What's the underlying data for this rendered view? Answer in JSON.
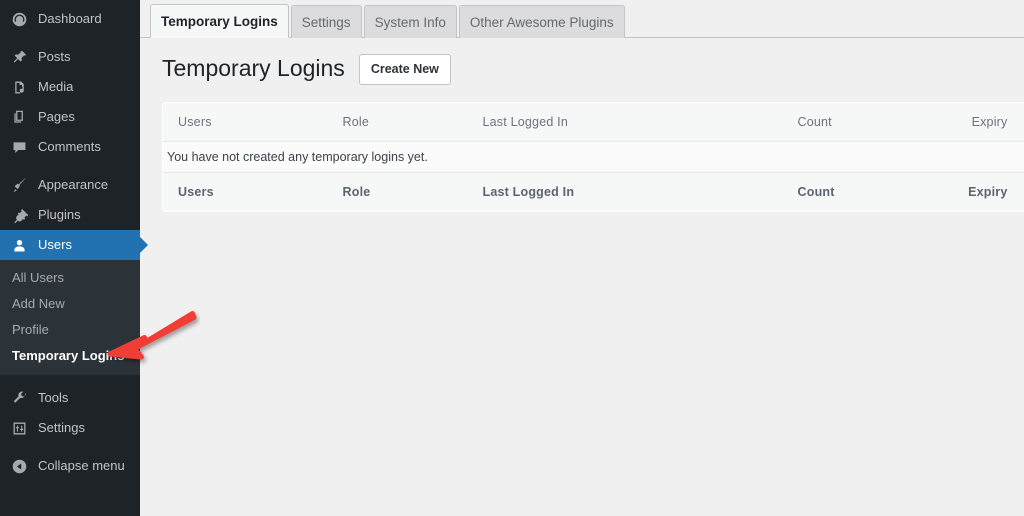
{
  "sidebar": {
    "items": [
      {
        "label": "Dashboard",
        "icon": "dashboard-icon",
        "name": "sidebar-item-dashboard",
        "current": false,
        "gap": false
      },
      {
        "label": "Posts",
        "icon": "pin-icon",
        "name": "sidebar-item-posts",
        "current": false,
        "gap": true
      },
      {
        "label": "Media",
        "icon": "media-icon",
        "name": "sidebar-item-media",
        "current": false,
        "gap": false
      },
      {
        "label": "Pages",
        "icon": "pages-icon",
        "name": "sidebar-item-pages",
        "current": false,
        "gap": false
      },
      {
        "label": "Comments",
        "icon": "comments-icon",
        "name": "sidebar-item-comments",
        "current": false,
        "gap": false
      },
      {
        "label": "Appearance",
        "icon": "paintbrush-icon",
        "name": "sidebar-item-appearance",
        "current": false,
        "gap": true
      },
      {
        "label": "Plugins",
        "icon": "plug-icon",
        "name": "sidebar-item-plugins",
        "current": false,
        "gap": false
      },
      {
        "label": "Users",
        "icon": "user-icon",
        "name": "sidebar-item-users",
        "current": true,
        "gap": false
      }
    ],
    "submenu": [
      {
        "label": "All Users",
        "name": "submenu-item-all-users",
        "current": false
      },
      {
        "label": "Add New",
        "name": "submenu-item-add-new",
        "current": false
      },
      {
        "label": "Profile",
        "name": "submenu-item-profile",
        "current": false
      },
      {
        "label": "Temporary Logins",
        "name": "submenu-item-temporary-logins",
        "current": true
      }
    ],
    "items_after": [
      {
        "label": "Tools",
        "icon": "wrench-icon",
        "name": "sidebar-item-tools",
        "current": false,
        "gap": true
      },
      {
        "label": "Settings",
        "icon": "settings-sliders-icon",
        "name": "sidebar-item-settings",
        "current": false,
        "gap": false
      }
    ],
    "collapse": {
      "label": "Collapse menu",
      "icon": "collapse-arrow-icon",
      "name": "collapse-menu-button"
    },
    "colors": {
      "background": "#1d2327",
      "submenu_background": "#2c3338",
      "current_highlight": "#2271b1"
    }
  },
  "tabs": [
    {
      "label": "Temporary Logins",
      "name": "tab-temporary-logins",
      "active": true
    },
    {
      "label": "Settings",
      "name": "tab-settings",
      "active": false
    },
    {
      "label": "System Info",
      "name": "tab-system-info",
      "active": false
    },
    {
      "label": "Other Awesome Plugins",
      "name": "tab-other-awesome-plugins",
      "active": false
    }
  ],
  "page": {
    "title": "Temporary Logins",
    "create_button": "Create New"
  },
  "table": {
    "columns": [
      "Users",
      "Role",
      "Last Logged In",
      "Count",
      "Expiry"
    ],
    "footer_columns": [
      "Users",
      "Role",
      "Last Logged In",
      "Count",
      "Expiry"
    ],
    "empty_message": "You have not created any temporary logins yet.",
    "rows": []
  },
  "annotation": {
    "arrow_color": "#f03c36",
    "points_to": "Temporary Logins"
  }
}
